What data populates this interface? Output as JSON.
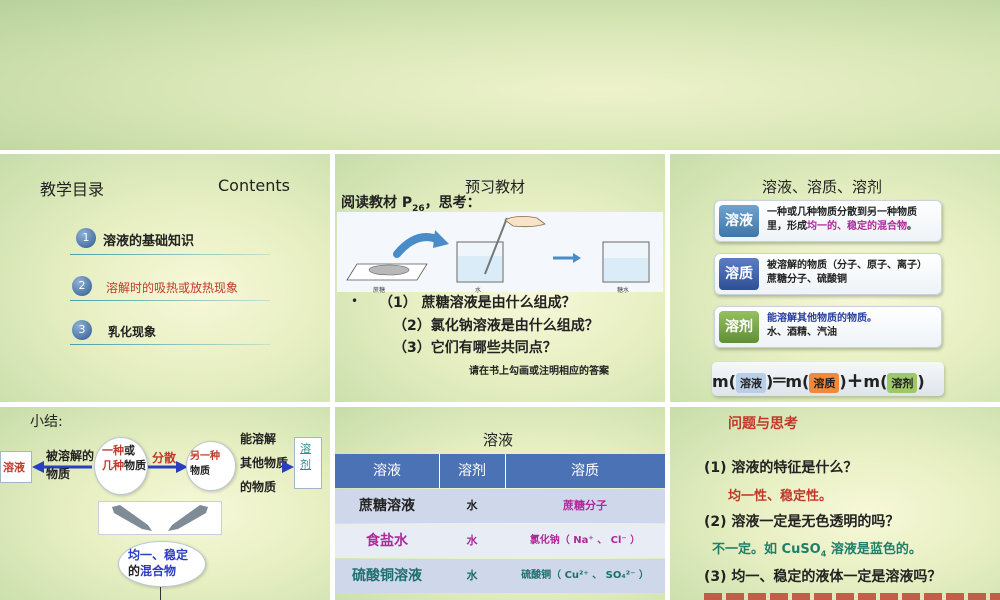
{
  "slide1": {
    "title": "教学目录",
    "title_en": "Contents",
    "items": [
      {
        "num": "1",
        "label": "溶液的基础知识",
        "color": "#222222"
      },
      {
        "num": "2",
        "label": "溶解时的吸热或放热现象",
        "color": "#c0392b"
      },
      {
        "num": "3",
        "label": "乳化现象",
        "color": "#222222"
      }
    ]
  },
  "slide2": {
    "title": "预习教材",
    "prompt_main": "阅读教材 P",
    "prompt_sub": "26",
    "prompt_end": "，思考：",
    "image_labels": [
      "蔗糖",
      "水",
      "糖水"
    ],
    "bullet": "•",
    "questions": [
      "（1） 蔗糖溶液是由什么组成？",
      "（2）氯化钠溶液是由什么组成？",
      "（3）它们有哪些共同点？"
    ],
    "note": "请在书上勾画或注明相应的答案"
  },
  "slide3": {
    "title": "溶液、溶质、溶剂",
    "defs": [
      {
        "tag": "溶液",
        "tag_color": "#4f87b8",
        "line1": "一种或几种物质分散到另一种物质",
        "line2_a": "里，形成",
        "line2_b": "均一的、稳定的混合物",
        "line2_c": "。"
      },
      {
        "tag": "溶质",
        "tag_color": "#3f61a8",
        "line1": "被溶解的物质（分子、原子、离子）",
        "line2_a": "蔗糖分子、硫酸铜",
        "line2_b": "",
        "line2_c": ""
      },
      {
        "tag": "溶剂",
        "tag_color": "#7aa84a",
        "line1": "能溶解其他物质的物质。",
        "line2_a": "水、酒精、汽油",
        "line2_b": "",
        "line2_c": ""
      }
    ],
    "formula": {
      "m1": "m(",
      "solution": "溶液",
      "close1": ")",
      "eq": "═",
      "m2": "m(",
      "solute": "溶质",
      "close2": ")",
      "plus": "+",
      "m3": "m(",
      "solvent": "溶剂",
      "close3": ")"
    }
  },
  "slide4": {
    "title": "小结:",
    "solution_label": "溶液",
    "being_dissolved": "被溶解的物质",
    "bubble1_a": "一种",
    "bubble1_b": "或",
    "bubble1_c": "几种",
    "bubble1_d": "物质",
    "disperse": "分散",
    "bubble2_a": "另一种",
    "bubble2_b": "物质",
    "can_dissolve_1": "能溶解",
    "can_dissolve_2": "其他物质",
    "can_dissolve_3": "的物质",
    "solvent_label": "溶剂",
    "uniform_1": "均一、稳定",
    "uniform_2": "的",
    "uniform_3": "混合物"
  },
  "slide5": {
    "title": "溶液",
    "headers": [
      "溶液",
      "溶剂",
      "溶质"
    ],
    "rows": [
      {
        "solution": "蔗糖溶液",
        "solvent": "水",
        "solute": "蔗糖分子",
        "sol_color": "#222222",
        "solute_color": "#b0289a"
      },
      {
        "solution": "食盐水",
        "solvent": "水",
        "solute": "氯化钠（ Na⁺ 、 Cl⁻ ）",
        "sol_color": "#b0289a",
        "solute_color": "#b0289a"
      },
      {
        "solution": "硫酸铜溶液",
        "solvent": "水",
        "solute": "硫酸铜（ Cu²⁺ 、 SO₄²⁻ ）",
        "sol_color": "#1e6f6f",
        "solute_color": "#1e6f6f"
      }
    ]
  },
  "slide6": {
    "title": "问题与思考",
    "q1": "(1) 溶液的特征是什么？",
    "a1": "均一性、稳定性。",
    "q2": "(2) 溶液一定是无色透明的吗？",
    "a2_a": "不一定。如 CuSO",
    "a2_sub": "4",
    "a2_b": " 溶液是蓝色的。",
    "q3": "(3) 均一、稳定的液体一定是溶液吗？"
  }
}
